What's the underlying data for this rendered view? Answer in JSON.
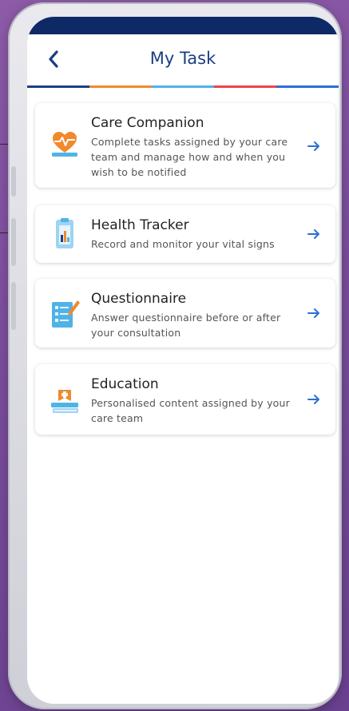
{
  "header": {
    "title": "My Task",
    "back_icon": "chevron-left-icon"
  },
  "colors": {
    "status_bar": "#0d2a66",
    "title": "#1b3f86",
    "stripe": [
      "#1b3f86",
      "#f08a2c",
      "#4fb3e8",
      "#e8454b",
      "#2b6fd6"
    ],
    "arrow": "#2b6fd6"
  },
  "tasks": [
    {
      "title": "Care Companion",
      "description": "Complete tasks assigned by your care team and manage how and when you wish to be notified",
      "icon": "heart-monitor-icon"
    },
    {
      "title": "Health Tracker",
      "description": "Record and monitor your vital signs",
      "icon": "health-tracker-icon"
    },
    {
      "title": "Questionnaire",
      "description": "Answer questionnaire before or after your consultation",
      "icon": "questionnaire-icon"
    },
    {
      "title": "Education",
      "description": "Personalised content assigned by your care team",
      "icon": "education-books-icon"
    }
  ]
}
